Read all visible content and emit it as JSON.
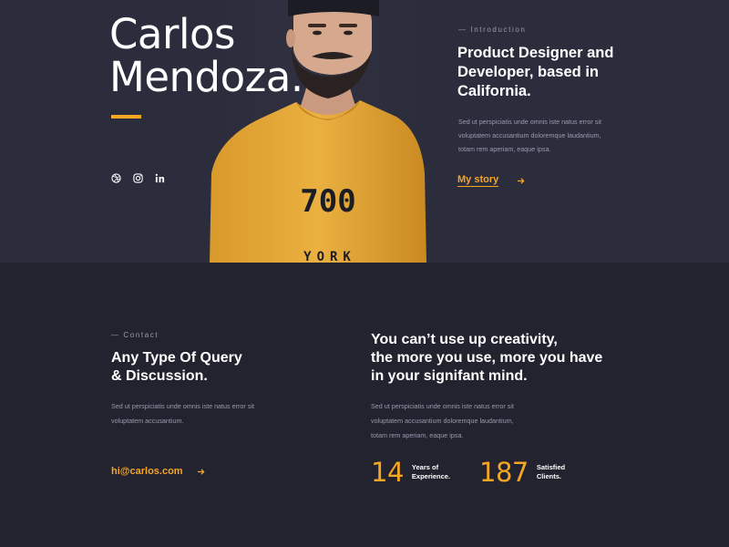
{
  "hero": {
    "name_line1": "Carlos",
    "name_line2": "Mendoza.",
    "accent_color": "#f5a623",
    "socials": [
      "dribbble-icon",
      "instagram-icon",
      "linkedin-icon"
    ],
    "shirt_print_line1": "700",
    "shirt_print_line2": "YORK"
  },
  "intro": {
    "eyebrow": "— Introduction",
    "title_line1": "Product Designer and",
    "title_line2": "Developer, based in",
    "title_line3": "California.",
    "body_line1": "Sed ut perspiciatis unde omnis iste natus error sit",
    "body_line2": "voluptatem accusantium doloremque laudantium,",
    "body_line3": "totam rem aperiam, eaque ipsa.",
    "cta_label": "My story"
  },
  "contact": {
    "eyebrow": "— Contact",
    "title_line1": "Any Type Of Query",
    "title_line2": "& Discussion.",
    "body_line1": "Sed ut perspiciatis unde omnis iste natus error sit",
    "body_line2": "voluptatem accusantium.",
    "email": "hi@carlos.com"
  },
  "quote": {
    "line1": "You can’t use up creativity,",
    "line2": "the more you use, more you have",
    "line3": "in your signifant mind.",
    "body_line1": "Sed ut perspiciatis unde omnis iste natus error sit",
    "body_line2": "voluptatem accusantium doloremque laudantium,",
    "body_line3": "totam rem aperiam, eaque ipsa."
  },
  "stats": {
    "years_value": "14",
    "years_label_line1": "Years of",
    "years_label_line2": "Experience.",
    "clients_value": "187",
    "clients_label_line1": "Satisfied",
    "clients_label_line2": "Clients."
  }
}
